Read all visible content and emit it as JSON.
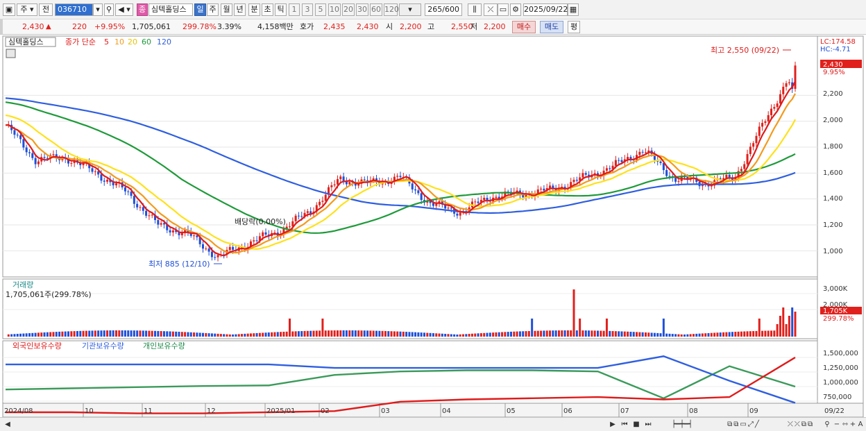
{
  "toolbar": {
    "market": "주",
    "prev": "전",
    "stock_code": "036710",
    "stock_name": "심텍홀딩스",
    "badge": "종",
    "periods": [
      "일",
      "주",
      "월",
      "년",
      "분",
      "초",
      "틱"
    ],
    "selected_period": "일",
    "intervals": [
      "1",
      "3",
      "5",
      "10",
      "20",
      "30",
      "60",
      "120"
    ],
    "count": "265",
    "count_total": "/600",
    "date": "2025/09/22"
  },
  "quote": {
    "price": "2,430",
    "arrow": "▲",
    "change": "220",
    "change_pct": "+9.95%",
    "volume": "1,705,061",
    "volume_pct": "299.78%",
    "turnover_pct": "3.39%",
    "amount": "4,158백만",
    "ask_label": "호가",
    "ask1": "2,435",
    "ask2": "2,430",
    "open_label": "시",
    "open": "2,200",
    "high_label": "고",
    "high": "2,550",
    "low_label": "저",
    "low": "2,200",
    "buy_label": "매수",
    "sell_label": "매도",
    "eval_label": "평"
  },
  "legend": {
    "stock": "심텍홀딩스",
    "ma_title": "종가 단순",
    "ma_periods": [
      "5",
      "10",
      "20",
      "60",
      "120"
    ],
    "lc_label": "LC:174.58",
    "hc_label": "HC:-4.71"
  },
  "annotations": {
    "high": "최고 2,550 (09/22)",
    "low": "최저 885 (12/10)",
    "dividend": "배당락(0.00%)"
  },
  "price_axis": {
    "ticks": [
      "2,200",
      "2,000",
      "1,800",
      "1,600",
      "1,400",
      "1,200",
      "1,000"
    ],
    "current": "2,430",
    "current_pct": "9.95%"
  },
  "volume_panel": {
    "title": "거래량",
    "value": "1,705,061주(299.78%)",
    "ticks": [
      "3,000K",
      "2,000K"
    ],
    "current": "1,705K",
    "current_pct": "299.78%"
  },
  "holdings_panel": {
    "series_labels": [
      "외국인보유수량",
      "기관보유수량",
      "개인보유수량"
    ],
    "ticks": [
      "1,500,000",
      "1,250,000",
      "1,000,000",
      "750,000"
    ]
  },
  "x_axis": {
    "labels": [
      "2024/08",
      "10",
      "11",
      "12",
      "2025/01",
      "02",
      "03",
      "04",
      "05",
      "06",
      "07",
      "08",
      "09"
    ],
    "end_label": "09/22"
  },
  "colors": {
    "up": "#e0201c",
    "down": "#1f4fd8",
    "ma5": "#e01a1a",
    "ma10": "#f39a1c",
    "ma20": "#ffe11a",
    "ma60": "#1e9a3a",
    "ma120": "#2f5fe0",
    "foreign": "#e01a1a",
    "institution": "#2f5fe0",
    "individual": "#3a9a5a"
  },
  "chart_data": {
    "type": "line",
    "x_range": [
      "2024/08",
      "2025/09/22"
    ],
    "price_ylim": [
      900,
      2550
    ],
    "high": {
      "value": 2550,
      "date": "09/22"
    },
    "low": {
      "value": 885,
      "date": "12/10"
    },
    "close": [
      [
        "2024/08",
        1970
      ],
      [
        "2024/09",
        1700
      ],
      [
        "2024/10",
        1720
      ],
      [
        "2024/10b",
        1600
      ],
      [
        "2024/11",
        1450
      ],
      [
        "2024/11b",
        1200
      ],
      [
        "2024/12",
        1130
      ],
      [
        "2024/12b",
        950
      ],
      [
        "2025/01",
        1060
      ],
      [
        "2025/01b",
        1150
      ],
      [
        "2025/02",
        1300
      ],
      [
        "2025/02b",
        1550
      ],
      [
        "2025/03",
        1520
      ],
      [
        "2025/03b",
        1570
      ],
      [
        "2025/04",
        1360
      ],
      [
        "2025/04b",
        1300
      ],
      [
        "2025/05",
        1420
      ],
      [
        "2025/05b",
        1440
      ],
      [
        "2025/06",
        1470
      ],
      [
        "2025/06b",
        1560
      ],
      [
        "2025/07",
        1650
      ],
      [
        "2025/07b",
        1780
      ],
      [
        "2025/08",
        1560
      ],
      [
        "2025/08b",
        1520
      ],
      [
        "2025/09",
        1560
      ],
      [
        "2025/09b",
        2000
      ],
      [
        "2025/09/22",
        2430
      ]
    ],
    "holdings": {
      "foreign": [
        560000,
        560000,
        540000,
        540000,
        560000,
        580000,
        740000,
        780000,
        800000,
        820000,
        780000,
        820000,
        1500000
      ],
      "institution": [
        1380000,
        1380000,
        1380000,
        1380000,
        1380000,
        1320000,
        1320000,
        1320000,
        1320000,
        1320000,
        1520000,
        1100000,
        720000
      ],
      "individual": [
        950000,
        970000,
        990000,
        1010000,
        1020000,
        1200000,
        1260000,
        1280000,
        1280000,
        1260000,
        800000,
        1350000,
        1000000
      ]
    }
  }
}
